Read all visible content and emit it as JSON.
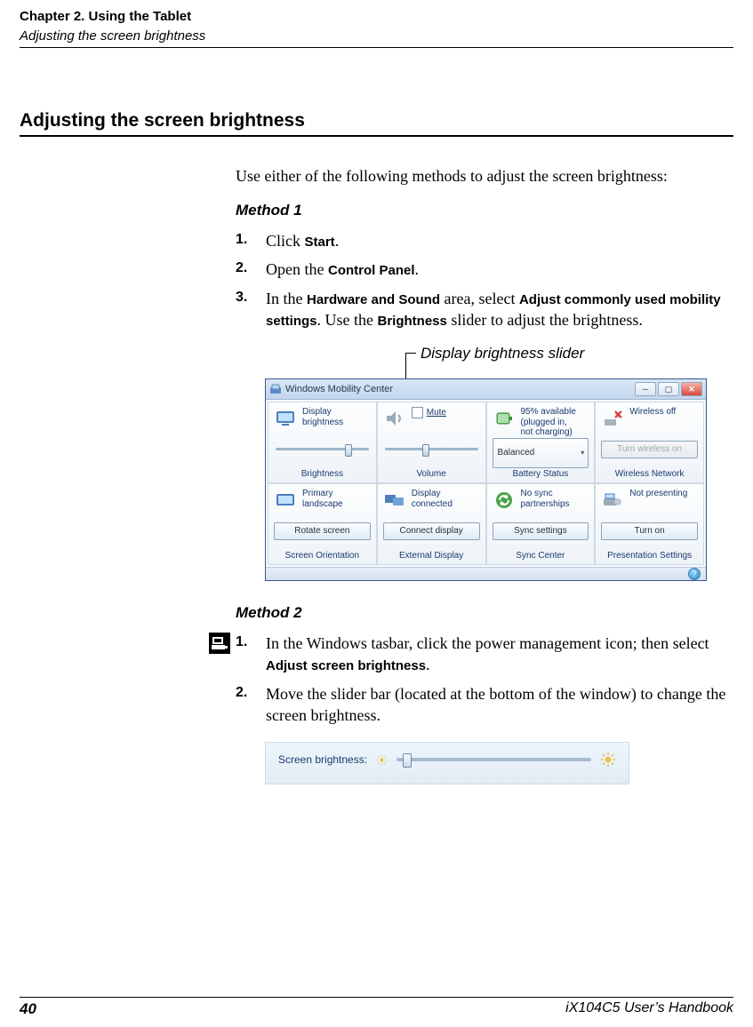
{
  "header": {
    "chapter": "Chapter 2. Using the Tablet",
    "section_sub": "Adjusting the screen brightness"
  },
  "section_heading": "Adjusting the screen brightness",
  "intro": "Use either of the following methods to adjust the screen brightness:",
  "method1": {
    "heading": "Method 1",
    "steps": {
      "s1": {
        "num": "1.",
        "pre": "Click ",
        "b1": "Start",
        "post": "."
      },
      "s2": {
        "num": "2.",
        "pre": "Open the ",
        "b1": "Control Panel",
        "post": "."
      },
      "s3": {
        "num": "3.",
        "t1": "In the ",
        "b1": "Hardware and Sound",
        "t2": " area, select ",
        "b2": "Adjust commonly used mobility settings",
        "t3": ". Use the ",
        "b3": "Brightness",
        "t4": " slider to adjust the brightness."
      }
    },
    "callout": "Display brightness slider"
  },
  "mobility_center": {
    "title": "Windows Mobility Center",
    "tiles": [
      {
        "label": "Display brightness",
        "control": "slider",
        "caption": "Brightness"
      },
      {
        "label": "Mute",
        "control": "slider_check",
        "caption": "Volume"
      },
      {
        "label": "95% available (plugged in, not charging)",
        "control": "combo",
        "combo_value": "Balanced",
        "caption": "Battery Status"
      },
      {
        "label": "Wireless off",
        "control": "button_disabled",
        "button": "Turn wireless on",
        "caption": "Wireless Network"
      },
      {
        "label": "Primary landscape",
        "control": "button",
        "button": "Rotate screen",
        "caption": "Screen Orientation"
      },
      {
        "label": "Display connected",
        "control": "button",
        "button": "Connect display",
        "caption": "External Display"
      },
      {
        "label": "No sync partnerships",
        "control": "button",
        "button": "Sync settings",
        "caption": "Sync Center"
      },
      {
        "label": "Not presenting",
        "control": "button",
        "button": "Turn on",
        "caption": "Presentation Settings"
      }
    ]
  },
  "method2": {
    "heading": "Method 2",
    "steps": {
      "s1": {
        "num": "1.",
        "t1": "In the Windows tasbar, click the power management icon; then select ",
        "b1": "Adjust screen brightness",
        "t2": "."
      },
      "s2": {
        "num": "2.",
        "t1": "Move the slider bar (located at the bottom of the window) to change the screen brightness."
      }
    }
  },
  "brightness_panel": {
    "label": "Screen brightness:"
  },
  "footer": {
    "page": "40",
    "book": "iX104C5 User’s Handbook"
  }
}
